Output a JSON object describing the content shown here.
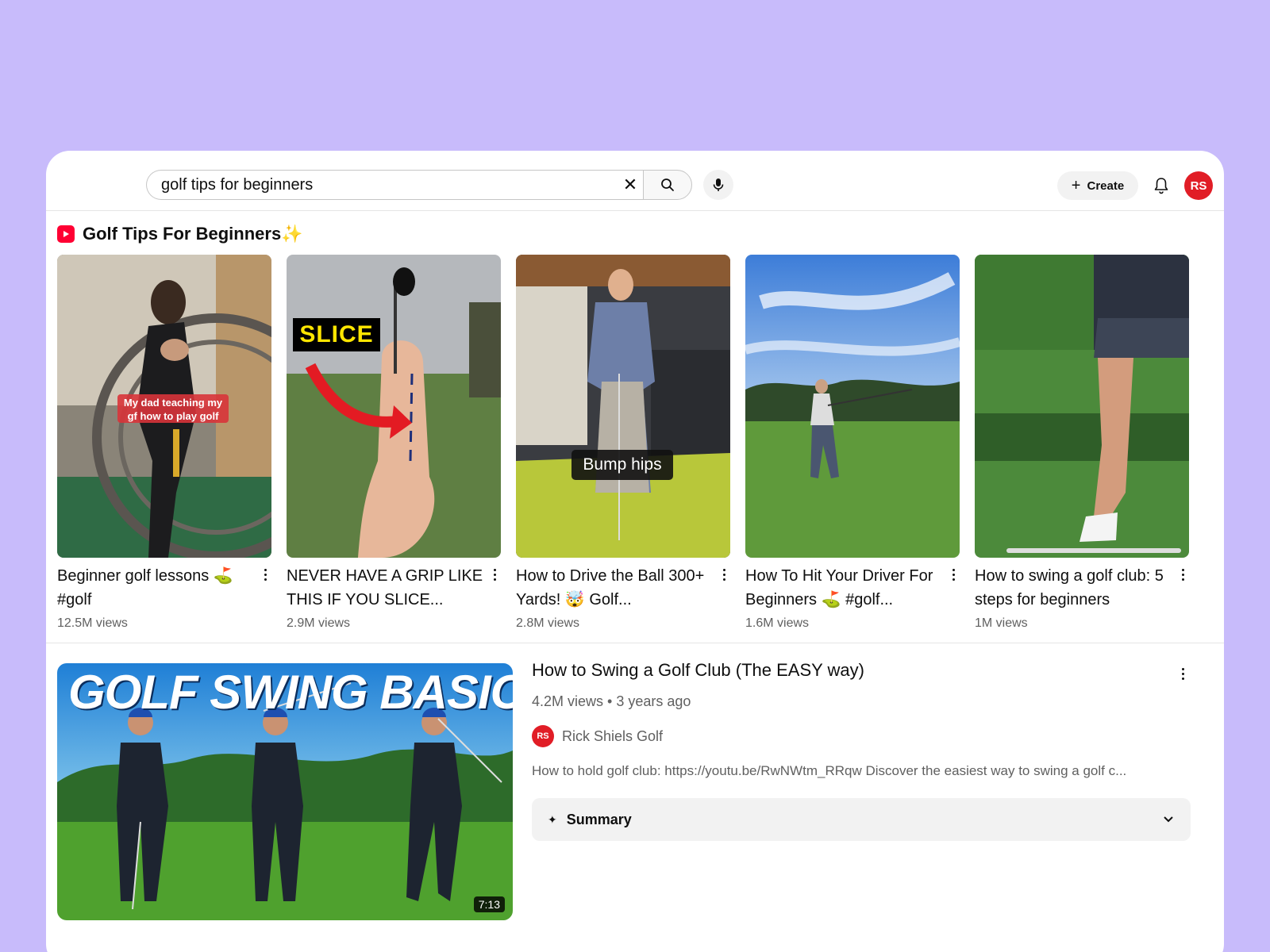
{
  "search": {
    "query": "golf tips for beginners",
    "clear_icon": "close-icon",
    "search_icon": "search-icon",
    "mic_icon": "mic-icon"
  },
  "header": {
    "create_label": "Create",
    "avatar_initials": "RS"
  },
  "shorts": {
    "section_title": "Golf Tips For Beginners",
    "section_emoji": "✨",
    "items": [
      {
        "title": "Beginner golf lessons ⛳ #golf",
        "views": "12.5M views",
        "overlay": "My dad teaching my gf how to play golf"
      },
      {
        "title": "NEVER HAVE A GRIP LIKE THIS IF YOU SLICE...",
        "views": "2.9M views",
        "overlay": "SLICE"
      },
      {
        "title": "How to Drive the Ball 300+ Yards! 🤯 Golf...",
        "views": "2.8M views",
        "overlay": "Bump hips"
      },
      {
        "title": "How To Hit Your Driver For Beginners ⛳ #golf...",
        "views": "1.6M views",
        "overlay": ""
      },
      {
        "title": "How to swing a golf club: 5 steps for beginners",
        "views": "1M views",
        "overlay": ""
      }
    ]
  },
  "video": {
    "title": "How to Swing a Golf Club (The EASY way)",
    "meta": "4.2M views • 3 years ago",
    "channel": "Rick Shiels Golf",
    "channel_initials": "RS",
    "description": "How to hold golf club: https://youtu.be/RwNWtm_RRqw Discover the easiest way to swing a golf c...",
    "duration": "7:13",
    "thumb_text": "GOLF SWING BASICS",
    "summary_label": "Summary"
  },
  "colors": {
    "background": "#c8bbfb",
    "brand_red": "#ff0033",
    "avatar_red": "#e11d26"
  }
}
